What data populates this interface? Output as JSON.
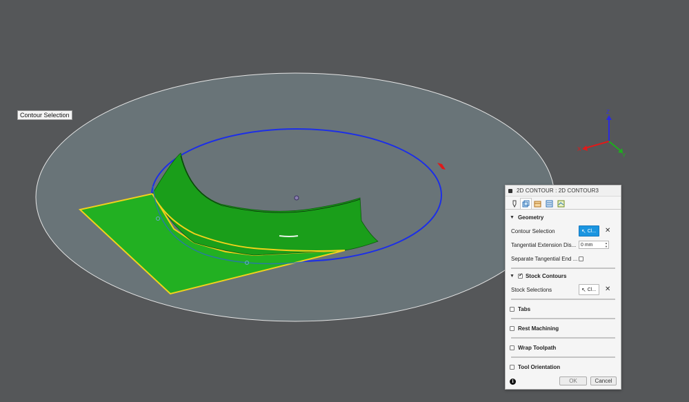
{
  "viewport": {
    "tooltip": "Contour Selection",
    "axes": {
      "z": "Z",
      "x": "X",
      "y": "Y"
    },
    "colors": {
      "surface": "#1faa1f",
      "highlight": "#f2d21b",
      "ring": "#2238e0",
      "background": "#555759",
      "plane": "#697478"
    }
  },
  "panel": {
    "title": "2D CONTOUR : 2D CONTOUR3",
    "tabs": [
      "tool-icon",
      "geometry-icon",
      "heights-icon",
      "passes-icon",
      "linking-icon"
    ],
    "geometry": {
      "header": "Geometry",
      "contour_selection_label": "Contour Selection",
      "contour_selection_value": "Cl...",
      "tangential_extension_label": "Tangential Extension Dis...",
      "tangential_extension_value": "0 mm",
      "separate_tangential_label": "Separate Tangential End ...",
      "separate_tangential_checked": false
    },
    "stock_contours": {
      "header": "Stock Contours",
      "checked": true,
      "stock_selections_label": "Stock Selections",
      "stock_selections_value": "Cl..."
    },
    "tabs_section": {
      "header": "Tabs",
      "checked": false
    },
    "rest_machining": {
      "header": "Rest Machining",
      "checked": false
    },
    "wrap_toolpath": {
      "header": "Wrap Toolpath",
      "checked": false
    },
    "tool_orientation": {
      "header": "Tool Orientation",
      "checked": false
    },
    "footer": {
      "ok": "OK",
      "cancel": "Cancel"
    }
  }
}
